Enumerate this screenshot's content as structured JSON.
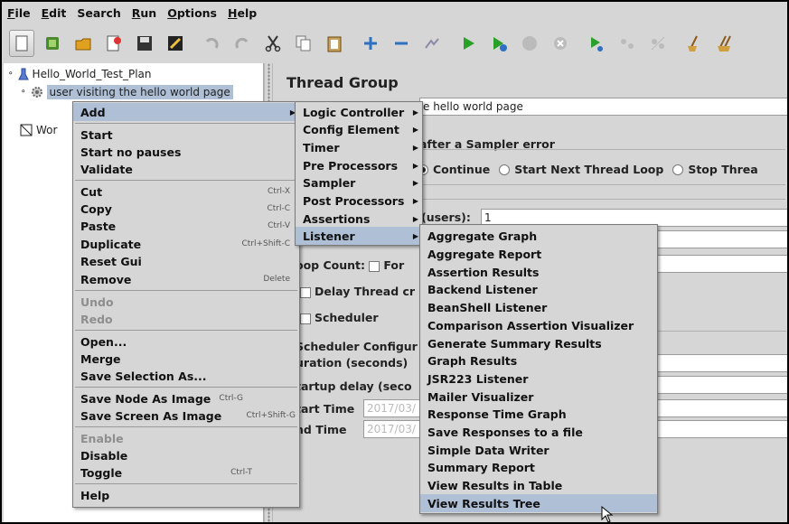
{
  "menubar": {
    "items": [
      {
        "u": "F",
        "rest": "ile"
      },
      {
        "u": "E",
        "rest": "dit"
      },
      {
        "u": "",
        "rest": "Search"
      },
      {
        "u": "R",
        "rest": "un"
      },
      {
        "u": "O",
        "rest": "ptions"
      },
      {
        "u": "H",
        "rest": "elp"
      }
    ]
  },
  "toolbar": {
    "icons": [
      "new-icon",
      "templates-icon",
      "open-icon",
      "close-icon",
      "save-icon",
      "save-screen-icon",
      "undo-icon",
      "redo-icon",
      "cut-icon",
      "copy-icon",
      "paste-icon",
      "expand-icon",
      "collapse-icon",
      "toggle-icon",
      "start-icon",
      "start-no-pauses-icon",
      "stop-icon",
      "shutdown-icon",
      "remote-start-icon",
      "remote-stop-icon",
      "remote-shutdown-icon",
      "clear-icon",
      "clear-all-icon"
    ]
  },
  "tree": {
    "test_plan": "Hello_World_Test_Plan",
    "thread_group": "user visiting the hello world page",
    "workbench": "Wor"
  },
  "panel": {
    "title": "Thread Group",
    "name_value": "e hello world page",
    "sampler_error_label": "after a Sampler error",
    "radio_continue": "Continue",
    "radio_next_loop": "Start Next Thread Loop",
    "radio_stop": "Stop Threa",
    "users_label": "(users):",
    "users_value": "1",
    "loop_count_label": "oop Count:",
    "forever_label": "For",
    "delay_label": "Delay Thread cr",
    "scheduler_label": "Scheduler",
    "scheduler_config": "Scheduler Configur",
    "duration_label": "uration (seconds)",
    "startup_delay_label": "tartup delay (seco",
    "start_time_label": "tart Time",
    "start_time_value": "2017/03/",
    "end_time_label": "nd Time",
    "end_time_value": "2017/03/"
  },
  "context_menu": {
    "add": "Add",
    "start": "Start",
    "start_no_pauses": "Start no pauses",
    "validate": "Validate",
    "cut": "Cut",
    "cut_sc": "Ctrl-X",
    "copy": "Copy",
    "copy_sc": "Ctrl-C",
    "paste": "Paste",
    "paste_sc": "Ctrl-V",
    "duplicate": "Duplicate",
    "duplicate_sc": "Ctrl+Shift-C",
    "reset_gui": "Reset Gui",
    "remove": "Remove",
    "remove_sc": "Delete",
    "undo": "Undo",
    "redo": "Redo",
    "open": "Open...",
    "merge": "Merge",
    "save_selection": "Save Selection As...",
    "save_node_image": "Save Node As Image",
    "save_node_image_sc": "Ctrl-G",
    "save_screen_image": "Save Screen As Image",
    "save_screen_image_sc": "Ctrl+Shift-G",
    "enable": "Enable",
    "disable": "Disable",
    "toggle": "Toggle",
    "toggle_sc": "Ctrl-T",
    "help": "Help"
  },
  "add_submenu": {
    "logic_controller": "Logic Controller",
    "config_element": "Config Element",
    "timer": "Timer",
    "pre_processors": "Pre Processors",
    "sampler": "Sampler",
    "post_processors": "Post Processors",
    "assertions": "Assertions",
    "listener": "Listener"
  },
  "listener_submenu": {
    "items": [
      "Aggregate Graph",
      "Aggregate Report",
      "Assertion Results",
      "Backend Listener",
      "BeanShell Listener",
      "Comparison Assertion Visualizer",
      "Generate Summary Results",
      "Graph Results",
      "JSR223 Listener",
      "Mailer Visualizer",
      "Response Time Graph",
      "Save Responses to a file",
      "Simple Data Writer",
      "Summary Report",
      "View Results in Table",
      "View Results Tree"
    ],
    "highlighted": "View Results Tree"
  },
  "colors": {
    "background": "#d6d6d6",
    "selection": "#aebfd6",
    "disabled_text": "#8e8e8e"
  }
}
